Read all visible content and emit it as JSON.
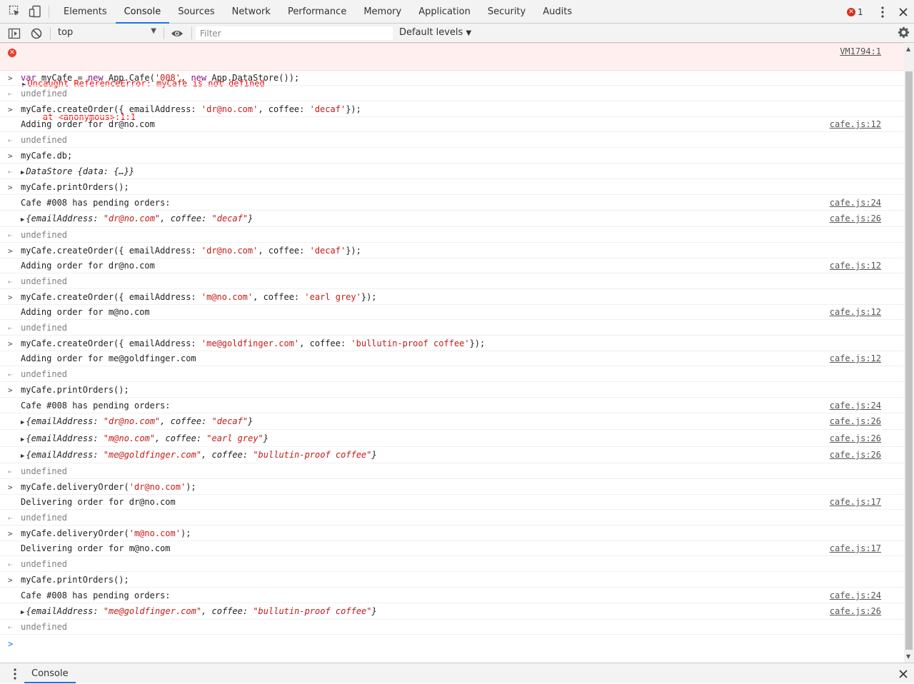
{
  "tabs": [
    "Elements",
    "Console",
    "Sources",
    "Network",
    "Performance",
    "Memory",
    "Application",
    "Security",
    "Audits"
  ],
  "active_tab": "Console",
  "error_count": "1",
  "toolbar": {
    "context": "top",
    "filter_placeholder": "Filter",
    "levels": "Default levels"
  },
  "error": {
    "message": "Uncaught ReferenceError: myCafe is not defined",
    "stack": "    at <anonymous>:1:1",
    "source": "VM1794:1"
  },
  "lines": [
    {
      "kind": "input",
      "h": 21,
      "parts": [
        [
          "kw",
          "var "
        ],
        [
          "plain",
          "myCafe = "
        ],
        [
          "kw",
          "new "
        ],
        [
          "plain",
          "App.Cafe("
        ],
        [
          "str",
          "'008'"
        ],
        [
          "plain",
          ", "
        ],
        [
          "kw",
          "new "
        ],
        [
          "plain",
          "App.DataStore());"
        ]
      ]
    },
    {
      "kind": "result",
      "h": 22,
      "parts": [
        [
          "undef",
          "undefined"
        ]
      ]
    },
    {
      "kind": "input",
      "h": 22,
      "parts": [
        [
          "plain",
          "myCafe.createOrder({ emailAddress: "
        ],
        [
          "str",
          "'dr@no.com'"
        ],
        [
          "plain",
          ", coffee: "
        ],
        [
          "str",
          "'decaf'"
        ],
        [
          "plain",
          "});"
        ]
      ]
    },
    {
      "kind": "log",
      "h": 21,
      "parts": [
        [
          "plain",
          "Adding order for dr@no.com"
        ]
      ],
      "source": "cafe.js:12"
    },
    {
      "kind": "result",
      "h": 22,
      "parts": [
        [
          "undef",
          "undefined"
        ]
      ]
    },
    {
      "kind": "input",
      "h": 22,
      "parts": [
        [
          "plain",
          "myCafe.db;"
        ]
      ]
    },
    {
      "kind": "result",
      "h": 22,
      "tri": true,
      "parts": [
        [
          "obj",
          "DataStore {data: {…}}"
        ]
      ]
    },
    {
      "kind": "input",
      "h": 22,
      "parts": [
        [
          "plain",
          "myCafe.printOrders();"
        ]
      ]
    },
    {
      "kind": "log",
      "h": 22,
      "parts": [
        [
          "plain",
          "Cafe #008 has pending orders:"
        ]
      ],
      "source": "cafe.js:24"
    },
    {
      "kind": "log",
      "h": 23,
      "tri": true,
      "parts": [
        [
          "obj",
          "{emailAddress: "
        ],
        [
          "ostr",
          "\"dr@no.com\""
        ],
        [
          "obj",
          ", coffee: "
        ],
        [
          "ostr",
          "\"decaf\""
        ],
        [
          "obj",
          "}"
        ]
      ],
      "source": "cafe.js:26"
    },
    {
      "kind": "result",
      "h": 22,
      "parts": [
        [
          "undef",
          "undefined"
        ]
      ]
    },
    {
      "kind": "input",
      "h": 22,
      "parts": [
        [
          "plain",
          "myCafe.createOrder({ emailAddress: "
        ],
        [
          "str",
          "'dr@no.com'"
        ],
        [
          "plain",
          ", coffee: "
        ],
        [
          "str",
          "'decaf'"
        ],
        [
          "plain",
          "});"
        ]
      ]
    },
    {
      "kind": "log",
      "h": 21,
      "parts": [
        [
          "plain",
          "Adding order for dr@no.com"
        ]
      ],
      "source": "cafe.js:12"
    },
    {
      "kind": "result",
      "h": 22,
      "parts": [
        [
          "undef",
          "undefined"
        ]
      ]
    },
    {
      "kind": "input",
      "h": 22,
      "parts": [
        [
          "plain",
          "myCafe.createOrder({ emailAddress: "
        ],
        [
          "str",
          "'m@no.com'"
        ],
        [
          "plain",
          ", coffee: "
        ],
        [
          "str",
          "'earl grey'"
        ],
        [
          "plain",
          "});"
        ]
      ]
    },
    {
      "kind": "log",
      "h": 21,
      "parts": [
        [
          "plain",
          "Adding order for m@no.com"
        ]
      ],
      "source": "cafe.js:12"
    },
    {
      "kind": "result",
      "h": 22,
      "parts": [
        [
          "undef",
          "undefined"
        ]
      ]
    },
    {
      "kind": "input",
      "h": 22,
      "parts": [
        [
          "plain",
          "myCafe.createOrder({ emailAddress: "
        ],
        [
          "str",
          "'me@goldfinger.com'"
        ],
        [
          "plain",
          ", coffee: "
        ],
        [
          "str",
          "'bullutin-proof coffee'"
        ],
        [
          "plain",
          "});"
        ]
      ]
    },
    {
      "kind": "log",
      "h": 21,
      "parts": [
        [
          "plain",
          "Adding order for me@goldfinger.com"
        ]
      ],
      "source": "cafe.js:12"
    },
    {
      "kind": "result",
      "h": 22,
      "parts": [
        [
          "undef",
          "undefined"
        ]
      ]
    },
    {
      "kind": "input",
      "h": 22,
      "parts": [
        [
          "plain",
          "myCafe.printOrders();"
        ]
      ]
    },
    {
      "kind": "log",
      "h": 22,
      "parts": [
        [
          "plain",
          "Cafe #008 has pending orders:"
        ]
      ],
      "source": "cafe.js:24"
    },
    {
      "kind": "log",
      "h": 23,
      "tri": true,
      "parts": [
        [
          "obj",
          "{emailAddress: "
        ],
        [
          "ostr",
          "\"dr@no.com\""
        ],
        [
          "obj",
          ", coffee: "
        ],
        [
          "ostr",
          "\"decaf\""
        ],
        [
          "obj",
          "}"
        ]
      ],
      "source": "cafe.js:26"
    },
    {
      "kind": "log",
      "h": 24,
      "tri": true,
      "parts": [
        [
          "obj",
          "{emailAddress: "
        ],
        [
          "ostr",
          "\"m@no.com\""
        ],
        [
          "obj",
          ", coffee: "
        ],
        [
          "ostr",
          "\"earl grey\""
        ],
        [
          "obj",
          "}"
        ]
      ],
      "source": "cafe.js:26"
    },
    {
      "kind": "log",
      "h": 23,
      "tri": true,
      "parts": [
        [
          "obj",
          "{emailAddress: "
        ],
        [
          "ostr",
          "\"me@goldfinger.com\""
        ],
        [
          "obj",
          ", coffee: "
        ],
        [
          "ostr",
          "\"bullutin-proof coffee\""
        ],
        [
          "obj",
          "}"
        ]
      ],
      "source": "cafe.js:26"
    },
    {
      "kind": "result",
      "h": 22,
      "parts": [
        [
          "undef",
          "undefined"
        ]
      ]
    },
    {
      "kind": "input",
      "h": 22,
      "parts": [
        [
          "plain",
          "myCafe.deliveryOrder("
        ],
        [
          "str",
          "'dr@no.com'"
        ],
        [
          "plain",
          ");"
        ]
      ]
    },
    {
      "kind": "log",
      "h": 21,
      "parts": [
        [
          "plain",
          "Delivering order for dr@no.com"
        ]
      ],
      "source": "cafe.js:17"
    },
    {
      "kind": "result",
      "h": 22,
      "parts": [
        [
          "undef",
          "undefined"
        ]
      ]
    },
    {
      "kind": "input",
      "h": 22,
      "parts": [
        [
          "plain",
          "myCafe.deliveryOrder("
        ],
        [
          "str",
          "'m@no.com'"
        ],
        [
          "plain",
          ");"
        ]
      ]
    },
    {
      "kind": "log",
      "h": 21,
      "parts": [
        [
          "plain",
          "Delivering order for m@no.com"
        ]
      ],
      "source": "cafe.js:17"
    },
    {
      "kind": "result",
      "h": 22,
      "parts": [
        [
          "undef",
          "undefined"
        ]
      ]
    },
    {
      "kind": "input",
      "h": 22,
      "parts": [
        [
          "plain",
          "myCafe.printOrders();"
        ]
      ]
    },
    {
      "kind": "log",
      "h": 22,
      "parts": [
        [
          "plain",
          "Cafe #008 has pending orders:"
        ]
      ],
      "source": "cafe.js:24"
    },
    {
      "kind": "log",
      "h": 23,
      "tri": true,
      "parts": [
        [
          "obj",
          "{emailAddress: "
        ],
        [
          "ostr",
          "\"me@goldfinger.com\""
        ],
        [
          "obj",
          ", coffee: "
        ],
        [
          "ostr",
          "\"bullutin-proof coffee\""
        ],
        [
          "obj",
          "}"
        ]
      ],
      "source": "cafe.js:26"
    },
    {
      "kind": "result",
      "h": 21,
      "parts": [
        [
          "undef",
          "undefined"
        ]
      ]
    }
  ],
  "drawer": {
    "tab": "Console"
  },
  "colors": {
    "accent": "#1a73e8",
    "error_bg": "#fff0f0",
    "error_text": "#ff0000",
    "string": "#c41a16",
    "keyword": "#881280"
  }
}
